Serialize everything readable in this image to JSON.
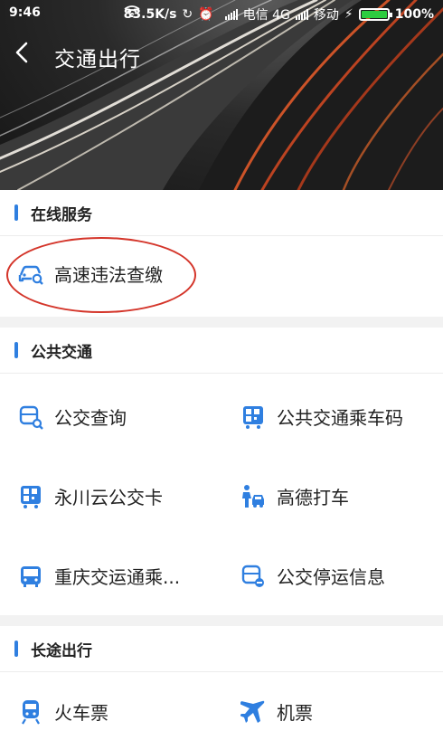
{
  "status_bar": {
    "time": "9:46",
    "net_speed": "83.5K/s",
    "carrier1": "电信 4G",
    "carrier2": "移动",
    "battery": "100%",
    "battery_level": 1.0,
    "battery_color": "#2ecc40"
  },
  "header": {
    "title": "交通出行"
  },
  "sections": {
    "online": {
      "title": "在线服务",
      "items": [
        {
          "label": "高速违法查缴",
          "icon": "car-search-icon"
        }
      ]
    },
    "public": {
      "title": "公共交通",
      "items": [
        {
          "label": "公交查询",
          "icon": "bus-search-icon"
        },
        {
          "label": "公共交通乘车码",
          "icon": "qr-bus-icon"
        },
        {
          "label": "永川云公交卡",
          "icon": "qr-card-icon"
        },
        {
          "label": "高德打车",
          "icon": "person-car-icon"
        },
        {
          "label": "重庆交运通乘...",
          "icon": "bus-front-icon"
        },
        {
          "label": "公交停运信息",
          "icon": "bus-stop-icon"
        }
      ]
    },
    "long": {
      "title": "长途出行",
      "items": [
        {
          "label": "火车票",
          "icon": "train-icon"
        },
        {
          "label": "机票",
          "icon": "plane-icon"
        }
      ]
    }
  },
  "colors": {
    "accent": "#2f7fe0",
    "highlight": "#d4352a",
    "icon": "#2f7fe0"
  }
}
